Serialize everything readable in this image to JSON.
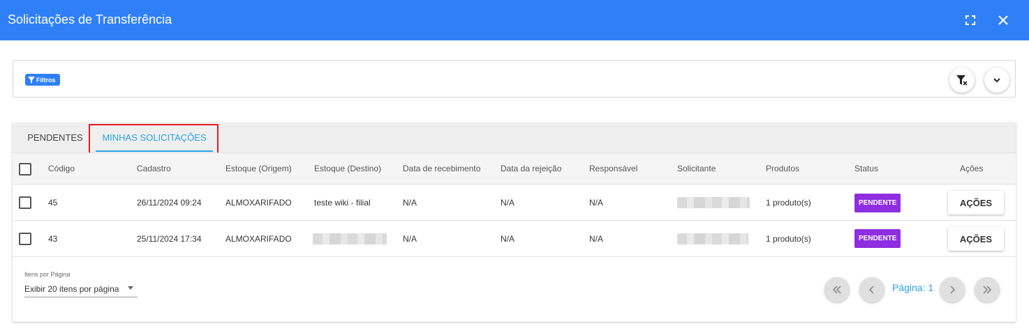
{
  "window": {
    "title": "Solicitações de Transferência"
  },
  "filters": {
    "chip_label": "Filtros"
  },
  "tabs": [
    {
      "label": "PENDENTES"
    },
    {
      "label": "MINHAS SOLICITAÇÕES"
    }
  ],
  "active_tab": "MINHAS SOLICITAÇÕES",
  "table": {
    "columns": [
      "Código",
      "Cadastro",
      "Estoque (Origem)",
      "Estoque (Destino)",
      "Data de recebimento",
      "Data da rejeição",
      "Responsável",
      "Solicitante",
      "Produtos",
      "Status",
      "Ações"
    ],
    "rows": [
      {
        "codigo": "45",
        "cadastro": "26/11/2024 09:24",
        "origem": "ALMOXARIFADO",
        "destino": "teste wiki - filial",
        "recebimento": "N/A",
        "rejeicao": "N/A",
        "responsavel": "N/A",
        "produtos": "1 produto(s)",
        "status": "PENDENTE",
        "acoes": "AÇÕES"
      },
      {
        "codigo": "43",
        "cadastro": "25/11/2024 17:34",
        "origem": "ALMOXARIFADO",
        "recebimento": "N/A",
        "rejeicao": "N/A",
        "responsavel": "N/A",
        "produtos": "1 produto(s)",
        "status": "PENDENTE",
        "acoes": "AÇÕES"
      }
    ]
  },
  "pagination": {
    "items_label": "Itens por Página",
    "items_value": "Exibir 20 itens por página",
    "page_label": "Página: 1"
  },
  "colors": {
    "header": "#2f80f6",
    "accent": "#2aa3e0",
    "status_pending": "#8e2ee0",
    "highlight": "#e51c1c"
  }
}
